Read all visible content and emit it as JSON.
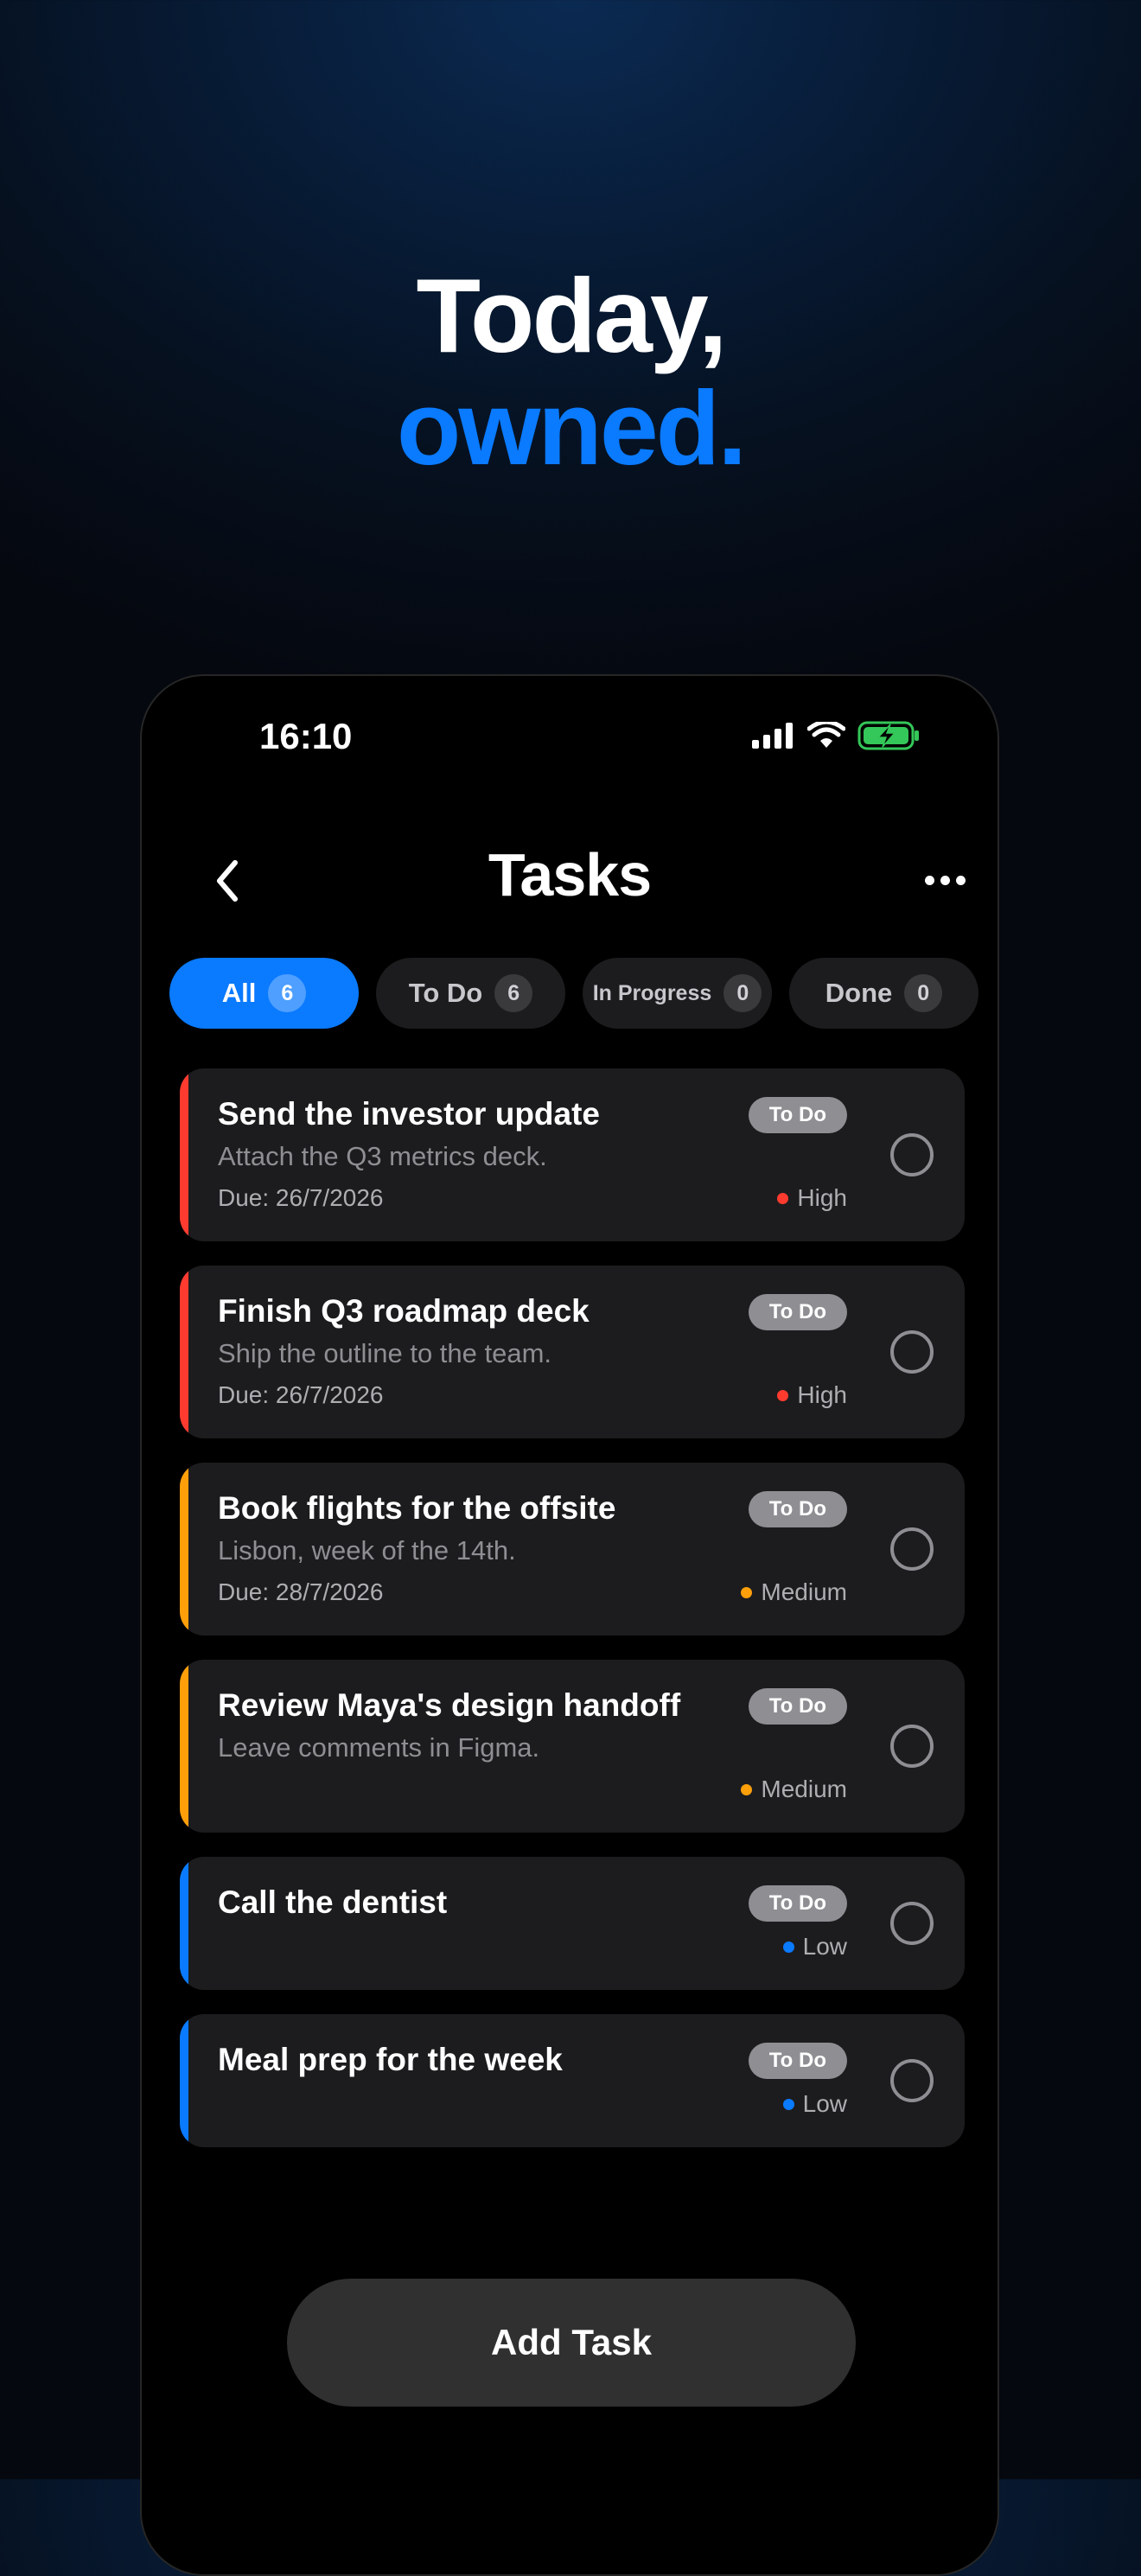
{
  "hero": {
    "line1": "Today,",
    "line2": "owned."
  },
  "status": {
    "time": "16:10"
  },
  "nav": {
    "title": "Tasks"
  },
  "tabs": [
    {
      "label": "All",
      "count": "6",
      "active": true
    },
    {
      "label": "To Do",
      "count": "6"
    },
    {
      "label": "In Progress",
      "count": "0"
    },
    {
      "label": "Done",
      "count": "0"
    }
  ],
  "tasks": [
    {
      "title": "Send the investor update",
      "subtitle": "Attach the Q3 metrics deck.",
      "due": "Due: 26/7/2026",
      "status": "To Do",
      "priority": "High",
      "priority_color": "#ff3b30"
    },
    {
      "title": "Finish Q3 roadmap deck",
      "subtitle": "Ship the outline to the team.",
      "due": "Due: 26/7/2026",
      "status": "To Do",
      "priority": "High",
      "priority_color": "#ff3b30"
    },
    {
      "title": "Book flights for the offsite",
      "subtitle": "Lisbon, week of the 14th.",
      "due": "Due: 28/7/2026",
      "status": "To Do",
      "priority": "Medium",
      "priority_color": "#ff9f0a"
    },
    {
      "title": "Review Maya's design handoff",
      "subtitle": "Leave comments in Figma.",
      "due": "",
      "status": "To Do",
      "priority": "Medium",
      "priority_color": "#ff9f0a"
    },
    {
      "title": "Call the dentist",
      "subtitle": "",
      "due": "",
      "status": "To Do",
      "priority": "Low",
      "priority_color": "#0a7aff"
    },
    {
      "title": "Meal prep for the week",
      "subtitle": "",
      "due": "",
      "status": "To Do",
      "priority": "Low",
      "priority_color": "#0a7aff"
    }
  ],
  "add_button": {
    "label": "Add Task"
  },
  "colors": {
    "accent": "#0a7aff",
    "card": "#1c1c1e",
    "battery": "#34c759"
  }
}
